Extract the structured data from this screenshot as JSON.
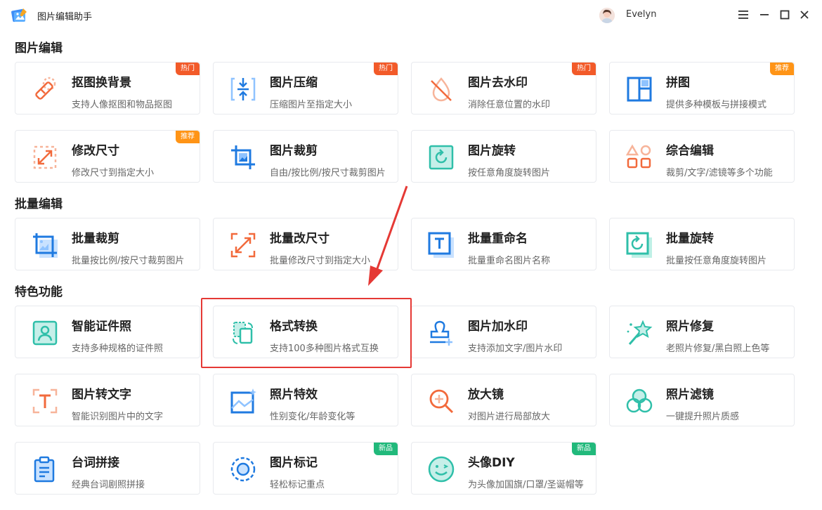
{
  "window": {
    "title": "图片编辑助手",
    "user": "Evelyn"
  },
  "sections": [
    {
      "title": "图片编辑"
    },
    {
      "title": "批量编辑"
    },
    {
      "title": "特色功能"
    }
  ],
  "cards": [
    {
      "title": "抠图换背景",
      "desc": "支持人像抠图和物品抠图",
      "badge": "热门",
      "icon": "eraser-icon"
    },
    {
      "title": "图片压缩",
      "desc": "压缩图片至指定大小",
      "badge": "热门",
      "icon": "compress-icon"
    },
    {
      "title": "图片去水印",
      "desc": "消除任意位置的水印",
      "badge": "热门",
      "icon": "no-watermark-icon"
    },
    {
      "title": "拼图",
      "desc": "提供多种模板与拼接模式",
      "badge": "推荐",
      "icon": "collage-icon"
    },
    {
      "title": "修改尺寸",
      "desc": "修改尺寸到指定大小",
      "badge": "推荐",
      "icon": "resize-icon"
    },
    {
      "title": "图片裁剪",
      "desc": "自由/按比例/按尺寸裁剪图片",
      "badge": "",
      "icon": "crop-icon"
    },
    {
      "title": "图片旋转",
      "desc": "按任意角度旋转图片",
      "badge": "",
      "icon": "rotate-icon"
    },
    {
      "title": "综合编辑",
      "desc": "裁剪/文字/滤镜等多个功能",
      "badge": "",
      "icon": "shapes-icon"
    },
    {
      "title": "批量裁剪",
      "desc": "批量按比例/按尺寸裁剪图片",
      "badge": "",
      "icon": "batch-crop-icon"
    },
    {
      "title": "批量改尺寸",
      "desc": "批量修改尺寸到指定大小",
      "badge": "",
      "icon": "batch-resize-icon"
    },
    {
      "title": "批量重命名",
      "desc": "批量重命名图片名称",
      "badge": "",
      "icon": "rename-icon"
    },
    {
      "title": "批量旋转",
      "desc": "批量按任意角度旋转图片",
      "badge": "",
      "icon": "batch-rotate-icon"
    },
    {
      "title": "智能证件照",
      "desc": "支持多种规格的证件照",
      "badge": "",
      "icon": "id-photo-icon"
    },
    {
      "title": "格式转换",
      "desc": "支持100多种图片格式互换",
      "badge": "",
      "icon": "format-convert-icon"
    },
    {
      "title": "图片加水印",
      "desc": "支持添加文字/图片水印",
      "badge": "",
      "icon": "stamp-icon"
    },
    {
      "title": "照片修复",
      "desc": "老照片修复/黑白照上色等",
      "badge": "",
      "icon": "magic-wand-icon"
    },
    {
      "title": "图片转文字",
      "desc": "智能识别图片中的文字",
      "badge": "",
      "icon": "ocr-text-icon"
    },
    {
      "title": "照片特效",
      "desc": "性别变化/年龄变化等",
      "badge": "",
      "icon": "photo-effect-icon"
    },
    {
      "title": "放大镜",
      "desc": "对图片进行局部放大",
      "badge": "",
      "icon": "magnifier-icon"
    },
    {
      "title": "照片滤镜",
      "desc": "一键提升照片质感",
      "badge": "",
      "icon": "filter-icon"
    },
    {
      "title": "台词拼接",
      "desc": "经典台词剧照拼接",
      "badge": "",
      "icon": "clipboard-icon"
    },
    {
      "title": "图片标记",
      "desc": "轻松标记重点",
      "badge": "新品",
      "icon": "mark-icon"
    },
    {
      "title": "头像DIY",
      "desc": "为头像加国旗/口罩/圣诞帽等",
      "badge": "新品",
      "icon": "smile-face-icon"
    }
  ]
}
